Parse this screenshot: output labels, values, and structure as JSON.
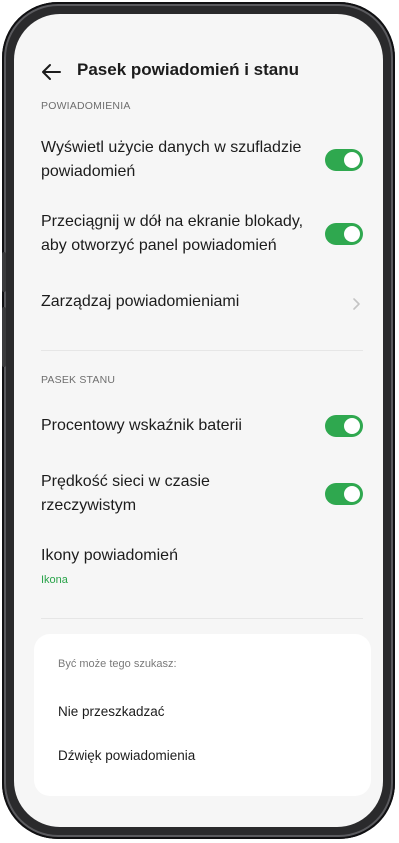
{
  "header": {
    "title": "Pasek powiadomień i stanu",
    "back_icon": "arrow-left-icon"
  },
  "sections": {
    "notifications": {
      "label": "POWIADOMIENIA",
      "items": [
        {
          "label": "Wyświetl użycie danych w szufladzie powiadomień",
          "toggle_on": true
        },
        {
          "label": "Przeciągnij w dół na ekranie blokady, aby otworzyć panel powiadomień",
          "toggle_on": true
        },
        {
          "label": "Zarządzaj powiadomieniami",
          "icon": "chevron-right-icon"
        }
      ]
    },
    "status_bar": {
      "label": "PASEK STANU",
      "items": [
        {
          "label": "Procentowy wskaźnik baterii",
          "toggle_on": true
        },
        {
          "label": "Prędkość sieci w czasie rzeczywistym",
          "toggle_on": true
        },
        {
          "label": "Ikony powiadomień",
          "value": "Ikona"
        }
      ]
    }
  },
  "suggestions": {
    "title": "Być może tego szukasz:",
    "items": [
      "Nie przeszkadzać",
      "Dźwięk powiadomienia"
    ]
  },
  "colors": {
    "accent": "#2fa84f",
    "background": "#f6f6f6",
    "frame": "#2a2a2c"
  }
}
